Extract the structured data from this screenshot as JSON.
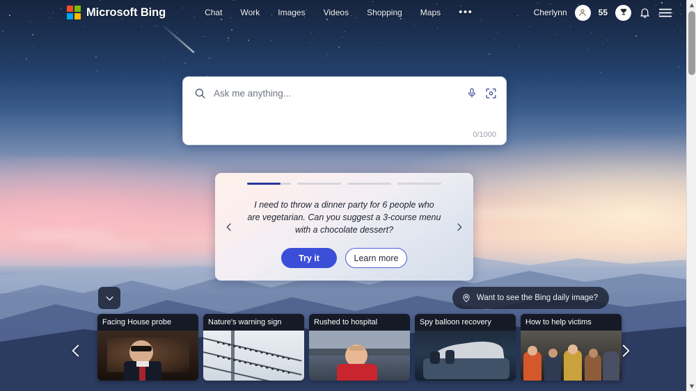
{
  "header": {
    "brand": "Microsoft Bing",
    "logo_icon": "microsoft-logo-icon",
    "logo_colors": [
      "#f25022",
      "#7fba00",
      "#00a4ef",
      "#ffb900"
    ],
    "nav": [
      {
        "label": "Chat"
      },
      {
        "label": "Work"
      },
      {
        "label": "Images"
      },
      {
        "label": "Videos"
      },
      {
        "label": "Shopping"
      },
      {
        "label": "Maps"
      }
    ],
    "more_label": "•••",
    "user_name": "Cherlynn",
    "avatar_icon": "user-avatar-icon",
    "points": "55",
    "rewards_icon": "rewards-trophy-icon",
    "notifications_icon": "bell-icon",
    "menu_icon": "hamburger-menu-icon"
  },
  "search": {
    "placeholder": "Ask me anything...",
    "value": "",
    "search_icon": "search-icon",
    "mic_icon": "microphone-icon",
    "lens_icon": "visual-search-icon",
    "char_count": "0/1000"
  },
  "suggestion": {
    "progress": [
      {
        "fill": 76
      },
      {
        "fill": 0
      },
      {
        "fill": 0
      },
      {
        "fill": 0
      }
    ],
    "text": "I need to throw a dinner party for 6 people who are vegetarian. Can you suggest a 3-course menu with a chocolate dessert?",
    "try_label": "Try it",
    "learn_label": "Learn more",
    "prev_icon": "chevron-left-icon",
    "next_icon": "chevron-right-icon",
    "accent_color": "#3b4ed8"
  },
  "bottom": {
    "expand_icon": "chevron-down-icon",
    "daily_image_label": "Want to see the Bing daily image?",
    "daily_image_icon": "location-pin-icon"
  },
  "news": {
    "prev_icon": "chevron-left-icon",
    "next_icon": "chevron-right-icon",
    "cards": [
      {
        "title": "Facing House probe"
      },
      {
        "title": "Nature's warning sign"
      },
      {
        "title": "Rushed to hospital"
      },
      {
        "title": "Spy balloon recovery"
      },
      {
        "title": "How to help victims"
      }
    ]
  },
  "scrollbar": {
    "up_icon": "scroll-up-arrow-icon",
    "down_icon": "scroll-down-arrow-icon"
  }
}
